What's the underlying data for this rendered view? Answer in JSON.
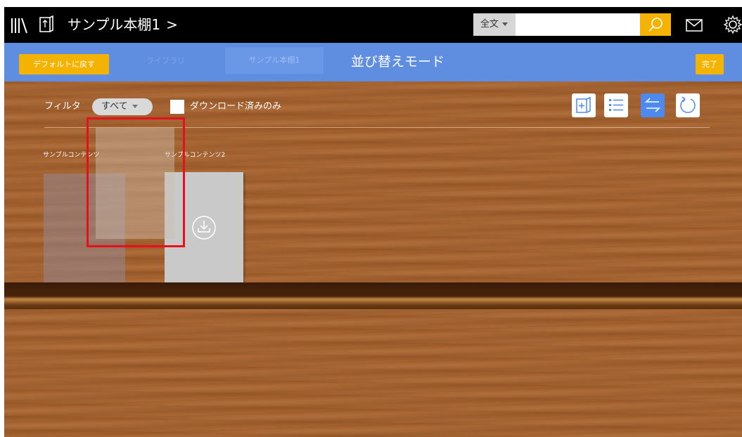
{
  "topbar": {
    "title": "サンプル本棚1",
    "title_chevron": ">",
    "search": {
      "mode": "全文",
      "value": "",
      "placeholder": ""
    },
    "icons": [
      "bookshelf-icon",
      "shelf-book-icon",
      "search-icon",
      "mail-icon",
      "gear-icon"
    ]
  },
  "modebar": {
    "default_button": "デフォルトに戻す",
    "ghost_tab_library": "ライブラリ",
    "tab_shelf": "サンプル本棚1",
    "title": "並び替えモード",
    "done_button": "完了"
  },
  "filter": {
    "label": "フィルタ",
    "selected": "すべて",
    "downloaded_only_label": "ダウンロード済みのみ",
    "downloaded_only_checked": false
  },
  "toolbar": {
    "icons": [
      "add-shelf-icon",
      "list-view-icon",
      "sort-icon",
      "refresh-icon"
    ],
    "active": "sort-icon"
  },
  "books": [
    {
      "title": "サンプルコンテンツ",
      "state": "being-dragged"
    },
    {
      "title": "サンプルコンテンツ2",
      "state": "not-downloaded",
      "icon": "download-icon"
    }
  ],
  "colors": {
    "topbar": "#000000",
    "modebar": "#5f8de0",
    "accent_orange": "#f5b301",
    "active_tool": "#4d8af0",
    "wood": "#a4612e",
    "drag_highlight": "#e8101c"
  }
}
